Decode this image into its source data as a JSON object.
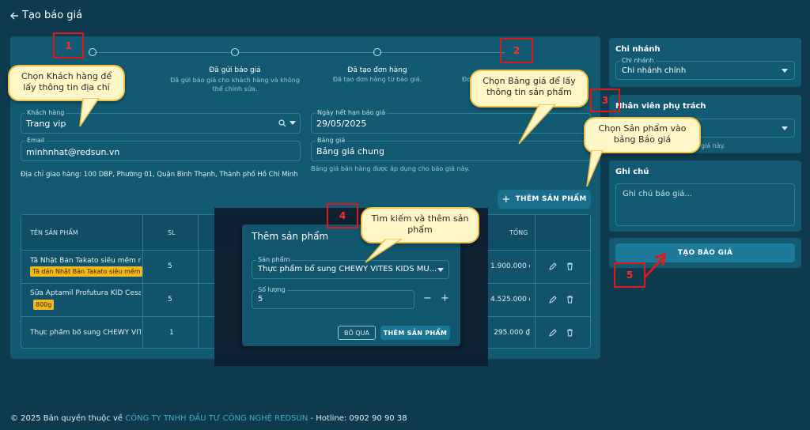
{
  "header": {
    "back_icon": "arrow-left-icon",
    "title": "Tạo báo giá"
  },
  "steps": [
    {
      "title": "Đã gửi báo giá",
      "desc": "Đã gửi báo giá cho khách hàng và không thể chỉnh sửa."
    },
    {
      "title": "Đã tạo đơn hàng",
      "desc": "Đã tạo đơn hàng từ báo giá."
    },
    {
      "title": "",
      "desc": "Đơ"
    }
  ],
  "form": {
    "customer": {
      "label": "Khách hàng",
      "value": "Trang vip"
    },
    "email": {
      "label": "Email",
      "value": "minhnhat@redsun.vn"
    },
    "address": "Địa chỉ giao hàng: 100 DBP, Phường 01, Quận Bình Thạnh, Thành phố Hồ Chí Minh",
    "expiry": {
      "label": "Ngày hết hạn báo giá",
      "value": "29/05/2025"
    },
    "pricelist": {
      "label": "Bảng giá",
      "value": "Bảng giá chung",
      "hint": "Bảng giá bán hàng được áp dụng cho báo giá này."
    },
    "add_product_label": "THÊM SẢN PHẨM"
  },
  "table": {
    "headers": {
      "name": "TÊN SẢN PHẨM",
      "qty": "SL",
      "total": "TỔNG"
    },
    "rows": [
      {
        "name": "Tã Nhật Bản Takato siêu mềm mại",
        "tag": "Tã dán Nhật Bản Takato siêu mềm m",
        "qty": "5",
        "total": "1.900.000 ₫"
      },
      {
        "name": "Sữa Aptamil Profutura KID Cesarb",
        "tag": "800g",
        "qty": "5",
        "total": "4.525.000 ₫"
      },
      {
        "name": "Thực phẩm bổ sung CHEWY VITE",
        "tag": "",
        "qty": "1",
        "total": "295.000 ₫"
      }
    ]
  },
  "modal": {
    "title": "Thêm sản phẩm",
    "product_label": "Sản phẩm",
    "product_value": "Thực phẩm bổ sung CHEWY VITES KIDS MU...",
    "qty_label": "Số lượng",
    "qty_value": "5",
    "cancel_label": "BỎ QUA",
    "confirm_label": "THÊM SẢN PHẨM"
  },
  "sidebar": {
    "branch": {
      "title": "Chi nhánh",
      "label": "Chi nhánh",
      "value": "Chi nhánh chính"
    },
    "staff": {
      "title": "Nhân viên phụ trách",
      "hint": "giá này."
    },
    "notes": {
      "title": "Ghi chú",
      "placeholder": "Ghi chú báo giá..."
    },
    "create_label": "TẠO BÁO GIÁ"
  },
  "callouts": {
    "c1": "Chọn Khách hàng để lấy thông tin địa chỉ",
    "c2": "Chọn Bảng giá để lấy thông tin sản phẩm",
    "c3": "Chọn Sản phẩm vào bảng Báo giá",
    "c4": "Tìm kiếm và thêm sản phẩm"
  },
  "markers": {
    "m1": "1",
    "m2": "2",
    "m3": "3",
    "m4": "4",
    "m5": "5"
  },
  "footer": {
    "copyright": "© 2025 Bản quyền thuộc về",
    "company": "CÔNG TY TNHH ĐẦU TƯ CÔNG NGHỆ REDSUN",
    "hotline": "- Hotline: 0902 90 90 38"
  },
  "colors": {
    "background": "#0d3a4c",
    "panel": "#125a72",
    "accent": "#1a6f8d",
    "marker": "#e01818",
    "callout": "#fff6c8",
    "tag": "#f2b81d"
  }
}
